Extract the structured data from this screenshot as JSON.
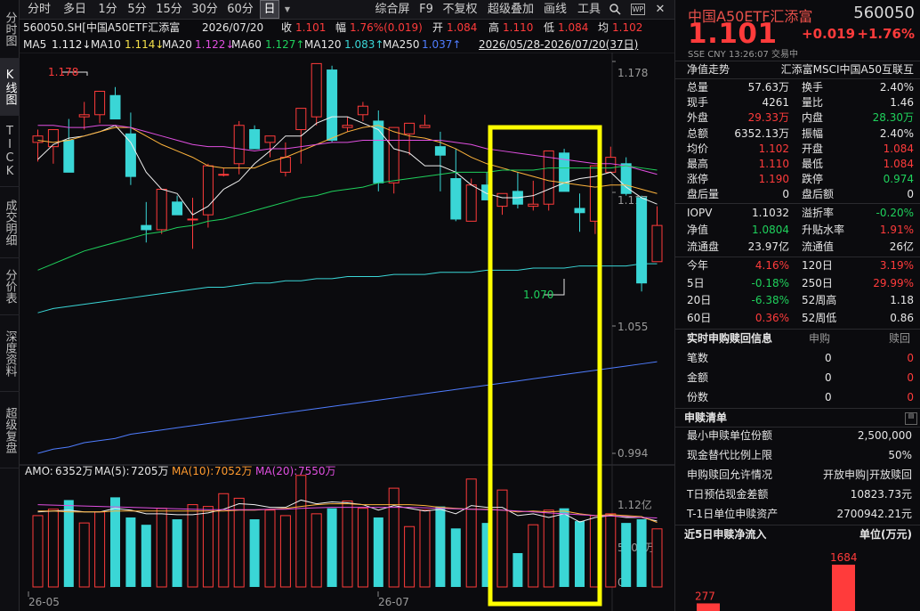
{
  "left_tabs": [
    "分时图",
    "K线图",
    "TICK",
    "成交明细",
    "分价表",
    "深度资料",
    "超级复盘"
  ],
  "toolbar": {
    "periods": [
      "分时",
      "多日",
      "1分",
      "5分",
      "15分",
      "30分",
      "60分",
      "日"
    ],
    "selected_period": "日",
    "dropdown_arrow": "▼",
    "tools": [
      "综合屏",
      "F9",
      "不复权",
      "超级叠加",
      "画线",
      "工具"
    ],
    "search_icon": "search-icon",
    "wp_label": "WP",
    "close_label": "✕"
  },
  "info": {
    "code_name": "560050.SH[中国A50ETF汇添富",
    "date": "2026/07/20",
    "close_label": "收",
    "close": "1.101",
    "amp_label": "幅",
    "amp": "1.76%(0.019)",
    "open_label": "开",
    "open": "1.084",
    "high_label": "高",
    "high": "1.110",
    "low_label": "低",
    "low": "1.084",
    "avg_label": "均",
    "avg": "1.102"
  },
  "ma_bar": {
    "items": [
      {
        "label": "MA5",
        "value": "1.112↓",
        "color": "#f0f0f0"
      },
      {
        "label": "MA10",
        "value": "1.114↓",
        "color": "#f5e14a"
      },
      {
        "label": "MA20",
        "value": "1.122↓",
        "color": "#e04fe0"
      },
      {
        "label": "MA60",
        "value": "1.127↑",
        "color": "#1fd15c"
      },
      {
        "label": "MA120",
        "value": "1.083↑",
        "color": "#3ad6d6"
      },
      {
        "label": "MA250",
        "value": "1.037↑",
        "color": "#4f7dff"
      }
    ],
    "range": "2026/05/28-2026/07/20(37日)"
  },
  "price_axis": [
    "1.178",
    "1.117",
    "1.055",
    "0.994"
  ],
  "annotations": {
    "high": "1.178",
    "low": "1.070"
  },
  "volume": {
    "amo_label": "AMO:",
    "amo": "6352万",
    "ma5_label": "MA(5):",
    "ma5": "7205万",
    "ma10_label": "MA(10):",
    "ma10": "7052万",
    "ma20_label": "MA(20):",
    "ma20": "7550万",
    "axis": [
      "1.12亿",
      "5600万",
      "0"
    ]
  },
  "x_dates": [
    "26-05",
    "26-07"
  ],
  "colors": {
    "up": "#ff3b3b",
    "down": "#3ad6d6",
    "highlight": "#ffff00",
    "ma5": "#f0f0f0",
    "ma10": "#ffb43c",
    "ma20": "#e04fe0",
    "ma60": "#1fd15c",
    "ma120": "#3ad6d6",
    "ma250": "#4f7dff"
  },
  "chart_data": {
    "type": "candlestick",
    "dates_shown": [
      "26-05",
      "26-07"
    ],
    "range_text": "2026/05/28-2026/07/20(37日)",
    "ylim": [
      0.994,
      1.178
    ],
    "candles": [
      {
        "o": 1.14,
        "h": 1.146,
        "l": 1.131,
        "c": 1.143
      },
      {
        "o": 1.138,
        "h": 1.146,
        "l": 1.13,
        "c": 1.146
      },
      {
        "o": 1.141,
        "h": 1.151,
        "l": 1.135,
        "c": 1.126
      },
      {
        "o": 1.152,
        "h": 1.159,
        "l": 1.146,
        "c": 1.153
      },
      {
        "o": 1.153,
        "h": 1.163,
        "l": 1.149,
        "c": 1.164
      },
      {
        "o": 1.162,
        "h": 1.166,
        "l": 1.154,
        "c": 1.151
      },
      {
        "o": 1.144,
        "h": 1.154,
        "l": 1.12,
        "c": 1.124
      },
      {
        "o": 1.101,
        "h": 1.112,
        "l": 1.093,
        "c": 1.099
      },
      {
        "o": 1.099,
        "h": 1.118,
        "l": 1.097,
        "c": 1.118
      },
      {
        "o": 1.112,
        "h": 1.115,
        "l": 1.109,
        "c": 1.106
      },
      {
        "o": 1.104,
        "h": 1.114,
        "l": 1.09,
        "c": 1.104
      },
      {
        "o": 1.106,
        "h": 1.13,
        "l": 1.1,
        "c": 1.129
      },
      {
        "o": 1.125,
        "h": 1.128,
        "l": 1.124,
        "c": 1.125
      },
      {
        "o": 1.13,
        "h": 1.15,
        "l": 1.125,
        "c": 1.148
      },
      {
        "o": 1.146,
        "h": 1.148,
        "l": 1.137,
        "c": 1.137
      },
      {
        "o": 1.14,
        "h": 1.143,
        "l": 1.133,
        "c": 1.143
      },
      {
        "o": 1.126,
        "h": 1.14,
        "l": 1.124,
        "c": 1.133
      },
      {
        "o": 1.146,
        "h": 1.155,
        "l": 1.13,
        "c": 1.156
      },
      {
        "o": 1.152,
        "h": 1.175,
        "l": 1.148,
        "c": 1.177
      },
      {
        "o": 1.174,
        "h": 1.176,
        "l": 1.14,
        "c": 1.141
      },
      {
        "o": 1.147,
        "h": 1.152,
        "l": 1.145,
        "c": 1.148
      },
      {
        "o": 1.153,
        "h": 1.159,
        "l": 1.15,
        "c": 1.157
      },
      {
        "o": 1.15,
        "h": 1.155,
        "l": 1.117,
        "c": 1.121
      },
      {
        "o": 1.121,
        "h": 1.138,
        "l": 1.116,
        "c": 1.147
      },
      {
        "o": 1.144,
        "h": 1.148,
        "l": 1.134,
        "c": 1.149
      },
      {
        "o": 1.147,
        "h": 1.153,
        "l": 1.147,
        "c": 1.148
      },
      {
        "o": 1.138,
        "h": 1.145,
        "l": 1.117,
        "c": 1.134
      },
      {
        "o": 1.123,
        "h": 1.137,
        "l": 1.103,
        "c": 1.104
      },
      {
        "o": 1.103,
        "h": 1.123,
        "l": 1.104,
        "c": 1.12
      },
      {
        "o": 1.12,
        "h": 1.126,
        "l": 1.113,
        "c": 1.113
      },
      {
        "o": 1.11,
        "h": 1.114,
        "l": 1.106,
        "c": 1.116
      },
      {
        "o": 1.117,
        "h": 1.126,
        "l": 1.109,
        "c": 1.111
      },
      {
        "o": 1.11,
        "h": 1.122,
        "l": 1.108,
        "c": 1.111
      },
      {
        "o": 1.111,
        "h": 1.136,
        "l": 1.108,
        "c": 1.136
      },
      {
        "o": 1.135,
        "h": 1.137,
        "l": 1.117,
        "c": 1.117
      },
      {
        "o": 1.109,
        "h": 1.116,
        "l": 1.098,
        "c": 1.107
      },
      {
        "o": 1.103,
        "h": 1.128,
        "l": 1.097,
        "c": 1.129
      },
      {
        "o": 1.126,
        "h": 1.138,
        "l": 1.126,
        "c": 1.133
      },
      {
        "o": 1.13,
        "h": 1.133,
        "l": 1.115,
        "c": 1.116
      },
      {
        "o": 1.114,
        "h": 1.115,
        "l": 1.07,
        "c": 1.074
      },
      {
        "o": 1.084,
        "h": 1.11,
        "l": 1.084,
        "c": 1.101
      }
    ],
    "volume_wan": [
      7800,
      8500,
      9500,
      7000,
      8200,
      9800,
      7600,
      6800,
      8600,
      7400,
      9000,
      8800,
      10200,
      9700,
      7400,
      8400,
      7800,
      12200,
      8000,
      8600,
      9400,
      8600,
      7600,
      10800,
      6600,
      8400,
      8800,
      6400,
      11800,
      7000,
      10600,
      3700,
      6800,
      8400,
      8600,
      7200,
      7800,
      8000,
      7000,
      7400,
      6352
    ],
    "ylim_volume": [
      0,
      11200
    ],
    "ma_lines": {
      "ma5": [
        1.132,
        1.139,
        1.142,
        1.143,
        1.145,
        1.148,
        1.14,
        1.126,
        1.118,
        1.116,
        1.106,
        1.11,
        1.118,
        1.122,
        1.13,
        1.136,
        1.143,
        1.143,
        1.149,
        1.152,
        1.152,
        1.149,
        1.146,
        1.137,
        1.135,
        1.129,
        1.129,
        1.126,
        1.12,
        1.116,
        1.114,
        1.114,
        1.115,
        1.118,
        1.121,
        1.123,
        1.124,
        1.126,
        1.119,
        1.114,
        1.111
      ],
      "ma10": [
        1.141,
        1.14,
        1.141,
        1.143,
        1.145,
        1.147,
        1.147,
        1.143,
        1.139,
        1.136,
        1.133,
        1.129,
        1.128,
        1.128,
        1.128,
        1.131,
        1.133,
        1.136,
        1.139,
        1.142,
        1.145,
        1.147,
        1.148,
        1.145,
        1.143,
        1.142,
        1.14,
        1.137,
        1.133,
        1.13,
        1.128,
        1.126,
        1.124,
        1.122,
        1.121,
        1.12,
        1.119,
        1.12,
        1.12,
        1.118,
        1.116
      ],
      "ma20": [
        1.148,
        1.148,
        1.147,
        1.147,
        1.148,
        1.148,
        1.147,
        1.145,
        1.143,
        1.141,
        1.139,
        1.138,
        1.138,
        1.137,
        1.136,
        1.137,
        1.137,
        1.138,
        1.139,
        1.14,
        1.14,
        1.141,
        1.141,
        1.141,
        1.141,
        1.141,
        1.141,
        1.14,
        1.139,
        1.137,
        1.136,
        1.135,
        1.134,
        1.133,
        1.132,
        1.131,
        1.13,
        1.13,
        1.129,
        1.127,
        1.125
      ],
      "ma60": [
        1.08,
        1.083,
        1.086,
        1.089,
        1.091,
        1.093,
        1.095,
        1.097,
        1.098,
        1.1,
        1.101,
        1.103,
        1.104,
        1.106,
        1.108,
        1.11,
        1.112,
        1.114,
        1.115,
        1.117,
        1.118,
        1.119,
        1.121,
        1.122,
        1.123,
        1.124,
        1.125,
        1.126,
        1.126,
        1.126,
        1.127,
        1.127,
        1.127,
        1.128,
        1.128,
        1.128,
        1.128,
        1.128,
        1.129,
        1.128,
        1.127
      ],
      "ma120": [
        1.06,
        1.062,
        1.063,
        1.064,
        1.065,
        1.066,
        1.067,
        1.068,
        1.069,
        1.07,
        1.071,
        1.072,
        1.072,
        1.073,
        1.074,
        1.074,
        1.075,
        1.075,
        1.076,
        1.076,
        1.077,
        1.077,
        1.077,
        1.078,
        1.078,
        1.078,
        1.079,
        1.079,
        1.079,
        1.08,
        1.08,
        1.08,
        1.081,
        1.081,
        1.081,
        1.082,
        1.082,
        1.082,
        1.082,
        1.083,
        1.083
      ],
      "ma250": [
        0.994,
        0.996,
        0.997,
        0.999,
        1.0,
        1.001,
        1.003,
        1.004,
        1.005,
        1.006,
        1.007,
        1.008,
        1.009,
        1.01,
        1.011,
        1.012,
        1.013,
        1.014,
        1.015,
        1.016,
        1.017,
        1.018,
        1.019,
        1.02,
        1.021,
        1.022,
        1.023,
        1.024,
        1.025,
        1.026,
        1.027,
        1.028,
        1.029,
        1.03,
        1.031,
        1.032,
        1.033,
        1.034,
        1.035,
        1.036,
        1.037
      ]
    },
    "volume_ma": {
      "ma5": [
        8200,
        8300,
        8400,
        8200,
        8200,
        8600,
        8400,
        8000,
        8000,
        7900,
        7900,
        8100,
        8500,
        9100,
        9000,
        8700,
        8700,
        9500,
        9100,
        9300,
        9200,
        9000,
        8400,
        8900,
        8600,
        8300,
        8500,
        8000,
        8900,
        8700,
        8700,
        7800,
        8000,
        7600,
        8000,
        7100,
        7600,
        7800,
        7600,
        7600,
        7205
      ],
      "ma10": [
        8300,
        8300,
        8200,
        8200,
        8200,
        8300,
        8300,
        8300,
        8300,
        8300,
        8300,
        8300,
        8300,
        8400,
        8400,
        8500,
        8600,
        8800,
        9000,
        9100,
        9100,
        9000,
        9000,
        9000,
        9000,
        8900,
        8700,
        8600,
        8500,
        8500,
        8400,
        8200,
        8300,
        8200,
        8300,
        8000,
        7800,
        7900,
        7800,
        7700,
        7052
      ],
      "ma20": [
        9000,
        8950,
        8900,
        8850,
        8800,
        8750,
        8700,
        8650,
        8600,
        8550,
        8500,
        8450,
        8450,
        8450,
        8450,
        8500,
        8500,
        8600,
        8650,
        8700,
        8700,
        8700,
        8700,
        8700,
        8700,
        8650,
        8600,
        8550,
        8500,
        8450,
        8400,
        8300,
        8200,
        8100,
        8000,
        7900,
        7800,
        7750,
        7700,
        7600,
        7550
      ]
    }
  },
  "right_panel": {
    "name": "中国A50ETF汇添富",
    "code": "560050",
    "price": "1.101",
    "change": "+0.019",
    "pct": "+1.76%",
    "sub": "SSE  CNY  13:26:07  交易中",
    "nav_trend": "净值走势",
    "index_name": "汇添富MSCI中国A50互联互",
    "quotes": [
      {
        "l1": "总量",
        "v1": "57.63万",
        "c1": "#e6e6e6",
        "l2": "换手",
        "v2": "2.40%",
        "c2": "#e6e6e6"
      },
      {
        "l1": "现手",
        "v1": "4261",
        "c1": "#e6e6e6",
        "l2": "量比",
        "v2": "1.46",
        "c2": "#e6e6e6"
      },
      {
        "l1": "外盘",
        "v1": "29.33万",
        "c1": "#ff3b3b",
        "l2": "内盘",
        "v2": "28.30万",
        "c2": "#1fd15c"
      },
      {
        "l1": "总额",
        "v1": "6352.13万",
        "c1": "#e6e6e6",
        "l2": "振幅",
        "v2": "2.40%",
        "c2": "#e6e6e6"
      },
      {
        "l1": "均价",
        "v1": "1.102",
        "c1": "#ff3b3b",
        "l2": "开盘",
        "v2": "1.084",
        "c2": "#ff3b3b"
      },
      {
        "l1": "最高",
        "v1": "1.110",
        "c1": "#ff3b3b",
        "l2": "最低",
        "v2": "1.084",
        "c2": "#ff3b3b"
      },
      {
        "l1": "涨停",
        "v1": "1.190",
        "c1": "#ff3b3b",
        "l2": "跌停",
        "v2": "0.974",
        "c2": "#1fd15c"
      },
      {
        "l1": "盘后量",
        "v1": "0",
        "c1": "#e6e6e6",
        "l2": "盘后额",
        "v2": "0",
        "c2": "#e6e6e6"
      }
    ],
    "iopv": [
      {
        "l1": "IOPV",
        "v1": "1.1032",
        "c1": "#e6e6e6",
        "l2": "溢折率",
        "v2": "-0.20%",
        "c2": "#1fd15c"
      },
      {
        "l1": "净值",
        "v1": "1.0804",
        "c1": "#1fd15c",
        "l2": "升贴水率",
        "v2": "1.91%",
        "c2": "#ff3b3b"
      },
      {
        "l1": "流通盘",
        "v1": "23.97亿",
        "c1": "#e6e6e6",
        "l2": "流通值",
        "v2": "26亿",
        "c2": "#e6e6e6"
      }
    ],
    "periods": [
      {
        "l1": "今年",
        "v1": "4.16%",
        "c1": "#ff3b3b",
        "l2": "120日",
        "v2": "3.19%",
        "c2": "#ff3b3b"
      },
      {
        "l1": "5日",
        "v1": "-0.18%",
        "c1": "#1fd15c",
        "l2": "250日",
        "v2": "29.99%",
        "c2": "#ff3b3b"
      },
      {
        "l1": "20日",
        "v1": "-6.38%",
        "c1": "#1fd15c",
        "l2": "52周高",
        "v2": "1.18",
        "c2": "#e6e6e6"
      },
      {
        "l1": "60日",
        "v1": "0.36%",
        "c1": "#ff3b3b",
        "l2": "52周低",
        "v2": "0.86",
        "c2": "#e6e6e6"
      }
    ],
    "realtime_title": "实时申购赎回信息",
    "rt_col1": "申购",
    "rt_col2": "赎回",
    "rt_rows": [
      {
        "label": "笔数",
        "sub": "0",
        "red": "0"
      },
      {
        "label": "金额",
        "sub": "0",
        "red": "0"
      },
      {
        "label": "份数",
        "sub": "0",
        "red": "0"
      }
    ],
    "list_title": "申赎清单",
    "list_rows": [
      {
        "label": "最小申赎单位份额",
        "value": "2,500,000"
      },
      {
        "label": "现金替代比例上限",
        "value": "50%"
      },
      {
        "label": "申购赎回允许情况",
        "value": "开放申购|开放赎回"
      },
      {
        "label": "T日预估现金差额",
        "value": "10823.73元"
      },
      {
        "label": "T-1日单位申赎资产",
        "value": "2700942.21元"
      }
    ],
    "net5_title": "近5日申赎净流入",
    "net5_unit": "单位(万元)",
    "net5_values": [
      {
        "label": "277",
        "value": 277
      },
      {
        "label": "1684",
        "value": 1684
      }
    ]
  }
}
